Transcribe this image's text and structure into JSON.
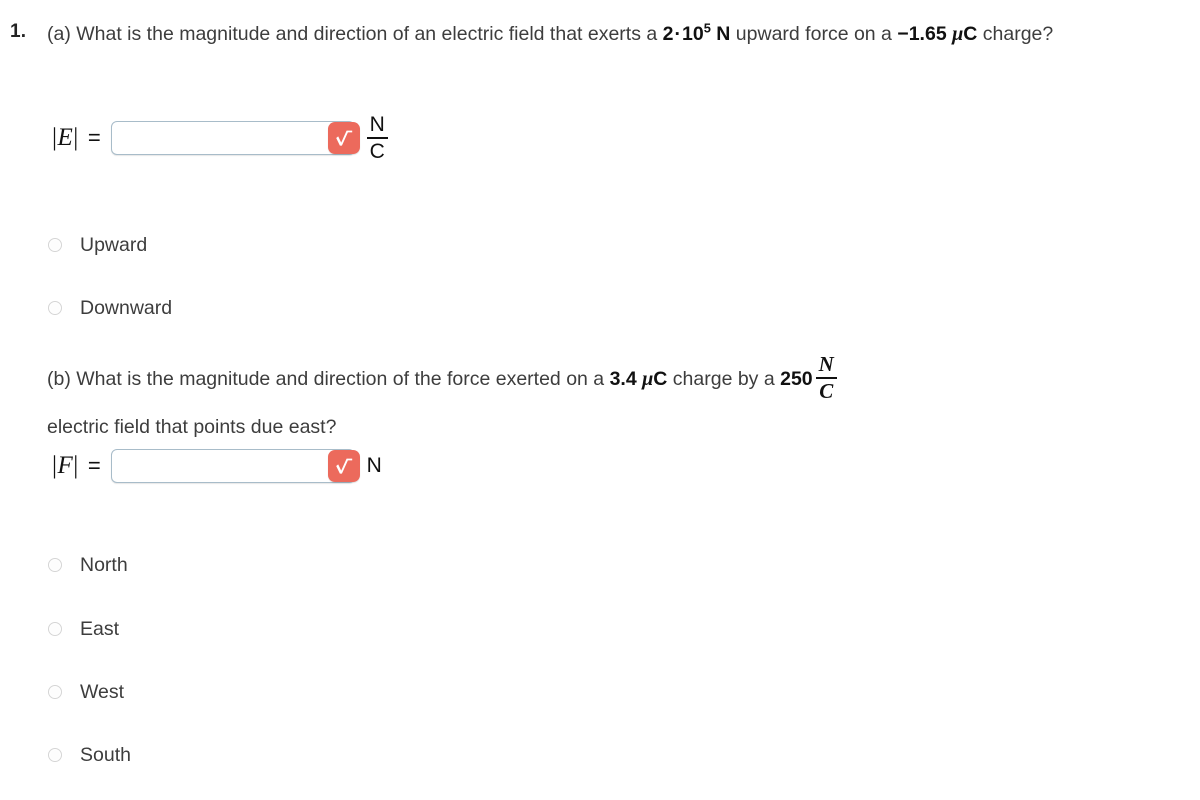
{
  "problem": {
    "number": "1.",
    "part_a": {
      "text_before_value": "(a) What is the magnitude and direction of an electric field that exerts a ",
      "force_value": "2",
      "force_dot": "·",
      "force_mantissa": "10",
      "force_exponent": "5",
      "force_unit": "N",
      "text_middle": " upward force on a ",
      "charge_value": "−1.65",
      "charge_mu": "μ",
      "charge_unit": "C",
      "text_after": " charge?"
    },
    "part_b": {
      "text_before_charge": "(b) What is the magnitude and direction of the force exerted on a ",
      "charge_value": "3.4",
      "charge_mu": "μ",
      "charge_unit": "C",
      "text_middle": " charge by a ",
      "field_value": "250",
      "field_unit_num": "N",
      "field_unit_den": "C",
      "text_after": "electric field that points due east?"
    }
  },
  "answers": {
    "field": {
      "label_open": "|",
      "label_var": "E",
      "label_close": "|",
      "equals": "=",
      "value": "",
      "placeholder": "",
      "unit_numerator": "N",
      "unit_denominator": "C",
      "sqrt_icon": "square-root-icon",
      "button_color": "#ec6a5c"
    },
    "force": {
      "label_open": "|",
      "label_var": "F",
      "label_close": "|",
      "equals": "=",
      "value": "",
      "placeholder": "",
      "unit": "N",
      "sqrt_icon": "square-root-icon",
      "button_color": "#ec6a5c"
    }
  },
  "options_a": [
    {
      "label": "Upward",
      "selected": false
    },
    {
      "label": "Downward",
      "selected": false
    }
  ],
  "options_b": [
    {
      "label": "North",
      "selected": false
    },
    {
      "label": "East",
      "selected": false
    },
    {
      "label": "West",
      "selected": false
    },
    {
      "label": "South",
      "selected": false
    }
  ]
}
